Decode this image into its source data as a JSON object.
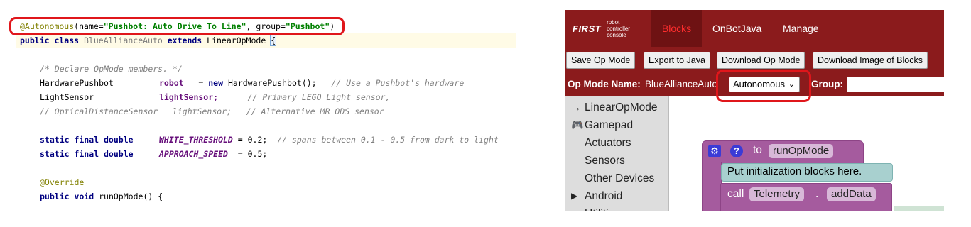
{
  "code": {
    "annotation_line": {
      "annotation": "@Autonomous",
      "p1": "(name=",
      "name_value": "\"Pushbot: Auto Drive To Line\"",
      "p2": ", group=",
      "group_value": "\"Pushbot\"",
      "p3": ")"
    },
    "class_line": {
      "kw1": "public class",
      "class_name": "BlueAllianceAuto",
      "kw2": "extends",
      "parent": "LinearOpMode",
      "brace": "{"
    },
    "comment_members": "/* Declare OpMode members. */",
    "robot_line": {
      "type": "HardwarePushbot",
      "var": "robot",
      "eq": "   = ",
      "kw": "new",
      "ctor": "HardwarePushbot();",
      "comment": "// Use a Pushbot's hardware"
    },
    "light_line": {
      "type": "LightSensor",
      "var": "lightSensor;",
      "comment": "// Primary LEGO Light sensor,"
    },
    "optical_line": "// OpticalDistanceSensor   lightSensor;   // Alternative MR ODS sensor",
    "white_line": {
      "kw": "static final double",
      "const": "WHITE_THRESHOLD",
      "val": " = 0.2;",
      "comment": "// spans between 0.1 - 0.5 from dark to light"
    },
    "approach_line": {
      "kw": "static final double",
      "const": "APPROACH_SPEED",
      "val": "  = 0.5;"
    },
    "override": "@Override",
    "run_line": {
      "kw": "public void",
      "rest": "runOpMode() {"
    }
  },
  "blocks_app": {
    "logo": {
      "first": "FIRST",
      "sub1": "robot",
      "sub2": "controller",
      "sub3": "console"
    },
    "nav": {
      "blocks": "Blocks",
      "onbotjava": "OnBotJava",
      "manage": "Manage"
    },
    "toolbar": {
      "save": "Save Op Mode",
      "export": "Export to Java",
      "download": "Download Op Mode",
      "download_image": "Download Image of Blocks"
    },
    "opmode_name_label": "Op Mode Name:",
    "opmode_name_value": "BlueAllianceAuto",
    "mode_select": "Autonomous",
    "group_label": "Group:",
    "toolbox": [
      {
        "icon": "→",
        "label": "LinearOpMode"
      },
      {
        "icon": "🎮",
        "label": "Gamepad"
      },
      {
        "icon": "",
        "label": "Actuators"
      },
      {
        "icon": "",
        "label": "Sensors"
      },
      {
        "icon": "",
        "label": "Other Devices"
      },
      {
        "icon": "▶",
        "label": "Android"
      },
      {
        "icon": "",
        "label": "Utilities"
      }
    ],
    "workspace": {
      "gear_icon": "⚙",
      "help_icon": "?",
      "to": "to",
      "func_name": "runOpMode",
      "init_comment": "Put initialization blocks here.",
      "call": "call",
      "target": "Telemetry",
      "dot": ".",
      "method": "addData"
    }
  },
  "colors": {
    "highlight": "#e0161b",
    "ftc_red": "#8b1b1c",
    "block_purple": "#a55b9e"
  }
}
